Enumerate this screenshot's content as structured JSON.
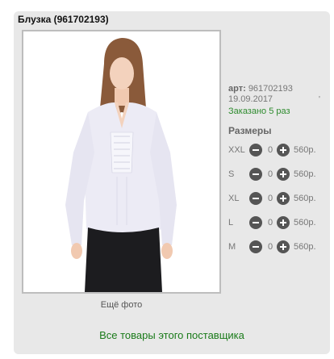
{
  "product": {
    "title": "Блузка (961702193)",
    "more_photos": "Ещё фото",
    "art_label": "арт:",
    "art_number": "961702193",
    "date": "19.09.2017",
    "ordered": "Заказано 5 раз",
    "tick_mark": "'",
    "sizes_title": "Размеры",
    "supplier_link": "Все товары этого поставщика"
  },
  "sizes": [
    {
      "name": "XXL",
      "qty": "0",
      "price": "560р."
    },
    {
      "name": "S",
      "qty": "0",
      "price": "560р."
    },
    {
      "name": "XL",
      "qty": "0",
      "price": "560р."
    },
    {
      "name": "L",
      "qty": "0",
      "price": "560р."
    },
    {
      "name": "M",
      "qty": "0",
      "price": "560р."
    }
  ],
  "icons": {
    "minus": "minus-circle-icon",
    "plus": "plus-circle-icon"
  },
  "colors": {
    "link_green": "#1a7b1a",
    "ordered_green": "#2e8b2e",
    "button_dark": "#555555",
    "card_bg": "#e8e8e8"
  }
}
